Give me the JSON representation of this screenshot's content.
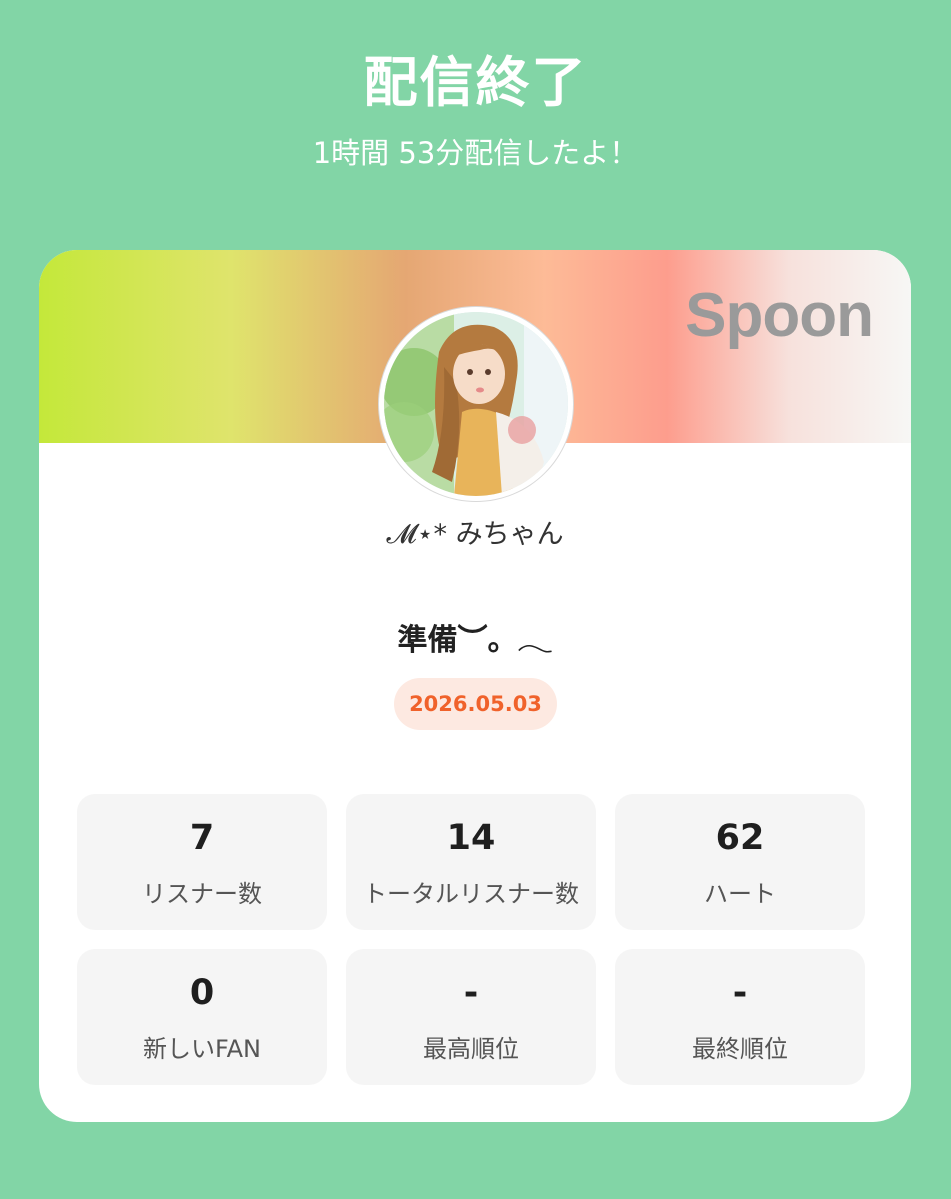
{
  "header": {
    "title": "配信終了",
    "subtitle": "1時間 53分配信したよ！"
  },
  "card": {
    "brand": "Spoon",
    "username": "𝓜⋆* みちゃん",
    "broadcast_title": "準備︶。𓂃",
    "date": "2026.05.03",
    "stats": [
      {
        "value": "7",
        "label": "リスナー数"
      },
      {
        "value": "14",
        "label": "トータルリスナー数"
      },
      {
        "value": "62",
        "label": "ハート"
      },
      {
        "value": "0",
        "label": "新しいFAN"
      },
      {
        "value": "-",
        "label": "最高順位"
      },
      {
        "value": "-",
        "label": "最終順位"
      }
    ]
  },
  "colors": {
    "background": "#82d5a6",
    "date_text": "#f0622b",
    "date_badge": "#fde9e1",
    "brand": "#9a9a9a"
  }
}
